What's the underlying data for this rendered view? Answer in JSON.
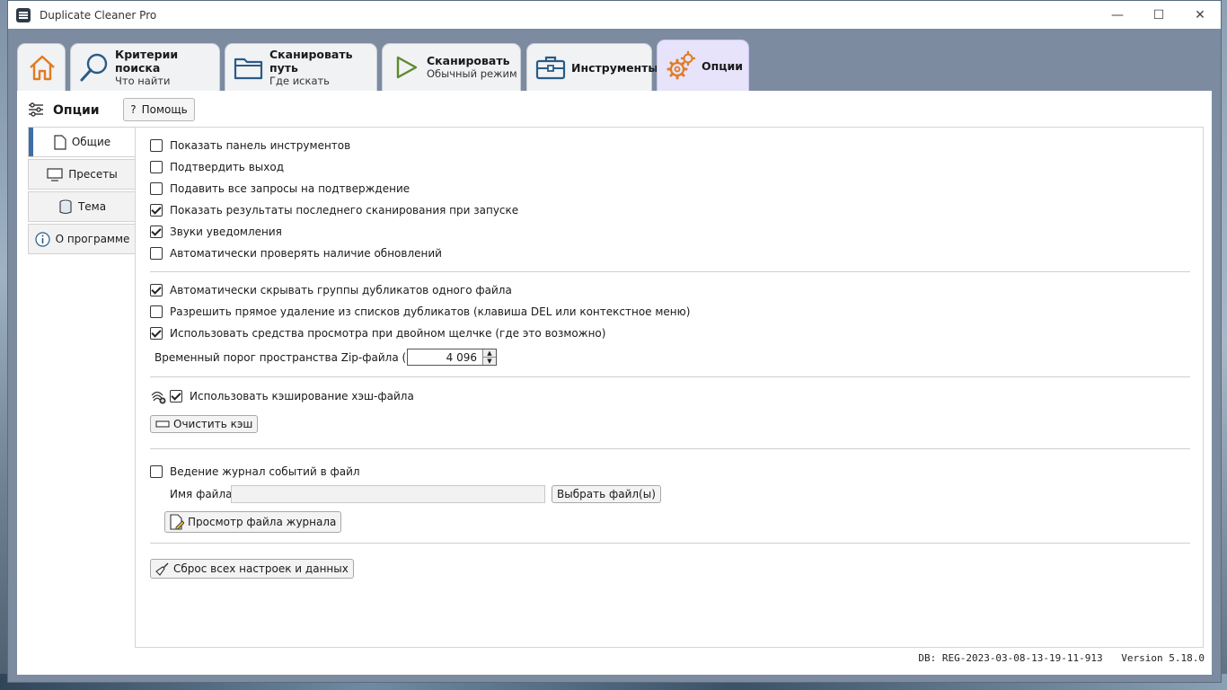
{
  "window": {
    "title": "Duplicate Cleaner Pro",
    "controls": {
      "minimize": "—",
      "maximize": "☐",
      "close": "✕"
    }
  },
  "tabs": [
    {
      "title": "",
      "subtitle": "",
      "icon": "home-icon"
    },
    {
      "title": "Критерии поиска",
      "subtitle": "Что найти",
      "icon": "search-icon"
    },
    {
      "title": "Сканировать путь",
      "subtitle": "Где искать",
      "icon": "folder-icon"
    },
    {
      "title": "Сканировать",
      "subtitle": "Обычный режим",
      "icon": "play-icon"
    },
    {
      "title": "Инструменты",
      "subtitle": "",
      "icon": "toolbox-icon"
    },
    {
      "title": "Опции",
      "subtitle": "",
      "icon": "gears-icon",
      "active": true
    }
  ],
  "options": {
    "header": "Опции",
    "help_label": "Помощь",
    "help_glyph": "?"
  },
  "sidebar": {
    "items": [
      {
        "label": "Общие",
        "icon": "document-icon",
        "active": true
      },
      {
        "label": "Пресеты",
        "icon": "monitor-icon"
      },
      {
        "label": "Тема",
        "icon": "theme-icon"
      },
      {
        "label": "О программе",
        "icon": "info-icon"
      }
    ]
  },
  "general": {
    "group1": [
      {
        "label": "Показать панель инструментов",
        "checked": false
      },
      {
        "label": "Подтвердить выход",
        "checked": false
      },
      {
        "label": "Подавить все запросы на подтверждение",
        "checked": false
      },
      {
        "label": "Показать результаты последнего сканирования при запуске",
        "checked": true
      },
      {
        "label": "Звуки уведомления",
        "checked": true
      },
      {
        "label": "Автоматически проверять наличие обновлений",
        "checked": false
      }
    ],
    "group2": [
      {
        "label": "Автоматически скрывать группы дубликатов одного файла",
        "checked": true
      },
      {
        "label": "Разрешить прямое удаление из списков дубликатов (клавиша DEL или контекстное меню)",
        "checked": false
      },
      {
        "label": "Использовать средства просмотра при двойном щелчке (где это возможно)",
        "checked": true
      }
    ],
    "zip_threshold_label": "Временный порог пространства Zip-файла (MB)",
    "zip_threshold_value": "4 096",
    "hash_cache": {
      "label": "Использовать кэширование хэш-файла",
      "checked": true
    },
    "clear_cache_label": "Очистить кэш",
    "logging": {
      "label": "Ведение журнал событий в файл",
      "checked": false
    },
    "filename_label": "Имя файла",
    "filename_value": "",
    "choose_files_label": "Выбрать файл(ы)",
    "view_log_label": "Просмотр файла журнала",
    "reset_label": "Сброс всех настроек и данных"
  },
  "footer": {
    "db": "DB: REG-2023-03-08-13-19-11-913",
    "version": "Version 5.18.0"
  },
  "colors": {
    "accent": "#3d6fa8",
    "active_tab": "#e6e3fa",
    "icon_orange": "#e07b22",
    "icon_blue": "#2a5b86",
    "icon_green": "#5e8a2c"
  }
}
